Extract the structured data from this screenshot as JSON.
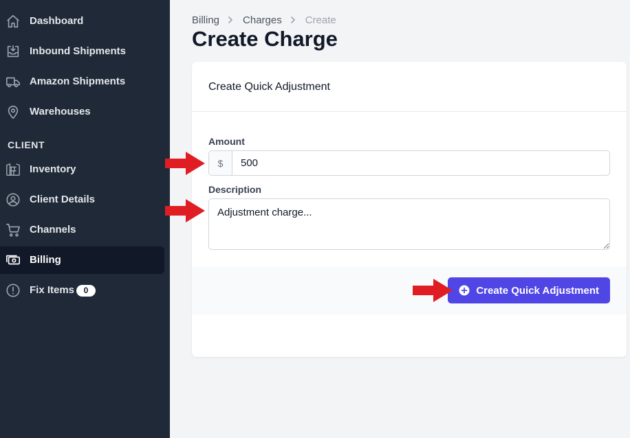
{
  "sidebar": {
    "items": [
      {
        "label": "Dashboard",
        "icon": "home-icon"
      },
      {
        "label": "Inbound Shipments",
        "icon": "inbox-download-icon"
      },
      {
        "label": "Amazon Shipments",
        "icon": "truck-icon"
      },
      {
        "label": "Warehouses",
        "icon": "map-pin-icon"
      },
      {
        "label": "Inventory",
        "icon": "warehouse-shelf-icon"
      },
      {
        "label": "Client Details",
        "icon": "user-circle-icon"
      },
      {
        "label": "Channels",
        "icon": "shopping-cart-icon"
      },
      {
        "label": "Billing",
        "icon": "cash-icon",
        "active": true
      },
      {
        "label": "Fix Items",
        "icon": "exclamation-circle-icon",
        "badge": "0"
      }
    ],
    "section_client": "CLIENT"
  },
  "header": {
    "breadcrumb": [
      "Billing",
      "Charges",
      "Create"
    ],
    "title": "Create Charge"
  },
  "card": {
    "title": "Create Quick Adjustment",
    "amount_label": "Amount",
    "amount_prefix": "$",
    "amount_value": "500",
    "description_label": "Description",
    "description_value": "Adjustment charge...",
    "submit_label": "Create Quick Adjustment"
  },
  "colors": {
    "sidebar_bg": "#1f2937",
    "active_item_bg": "#111827",
    "primary": "#4f46e5",
    "annotation_arrow": "#e11d24"
  }
}
